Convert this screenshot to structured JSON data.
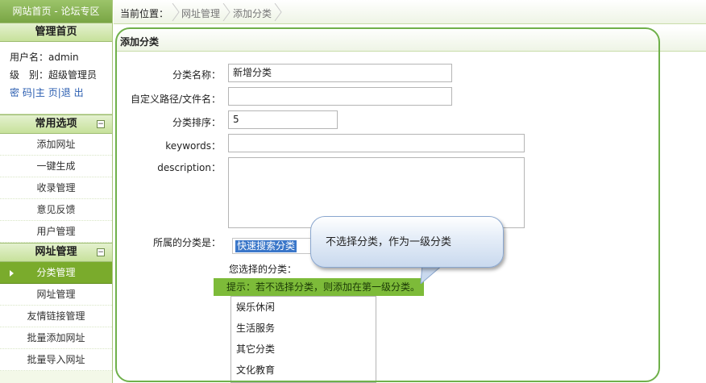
{
  "sidebar": {
    "top_link": "网站首页 - 论坛专区",
    "admin_home": "管理首页",
    "user": {
      "username_line": "用户名：admin",
      "level_line": "级　别：超级管理员",
      "link_password": "密 码",
      "link_home": "主 页",
      "link_logout": "退 出",
      "sep": "|"
    },
    "common": {
      "title": "常用选项",
      "collapse": "−",
      "items": [
        "添加网址",
        "一键生成",
        "收录管理",
        "意见反馈",
        "用户管理"
      ]
    },
    "url_mgmt": {
      "title": "网址管理",
      "collapse": "−",
      "items": [
        "分类管理",
        "网址管理",
        "友情链接管理",
        "批量添加网址",
        "批量导入网址"
      ]
    }
  },
  "breadcrumb": {
    "label": "当前位置：",
    "items": [
      "网址管理",
      "添加分类"
    ]
  },
  "form": {
    "section_title": "添加分类",
    "name_label": "分类名称：",
    "name_value": "新增分类",
    "path_label": "自定义路径/文件名：",
    "path_value": "",
    "order_label": "分类排序：",
    "order_value": "5",
    "keywords_label": "keywords：",
    "keywords_value": "",
    "description_label": "description：",
    "parent_label": "所属的分类是：",
    "quick_search": "快速搜索分类",
    "selected_label": "您选择的分类：",
    "hint": "提示：若不选择分类，则添加在第一级分类。",
    "categories": [
      "娱乐休闲",
      "生活服务",
      "其它分类",
      "文化教育"
    ]
  },
  "tooltip": {
    "text": "不选择分类，作为一级分类"
  },
  "colors": {
    "accent": "#7aab2c",
    "hint_bg": "#7dbb39",
    "outline": "#6fb04a"
  }
}
